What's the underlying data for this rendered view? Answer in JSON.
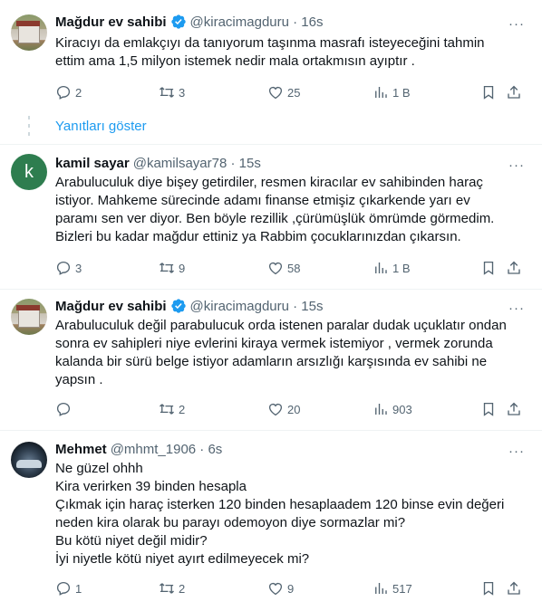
{
  "tweets": [
    {
      "name": "Mağdur ev sahibi",
      "verified": true,
      "handle_time": "@kiracimagduru · 16s",
      "text": "Kiracıyı da emlakçıyı da tanıyorum taşınma masrafı isteyeceğini tahmin\nettim ama 1,5 milyon istemek nedir mala ortakmısın ayıptır .",
      "replies": "2",
      "retweets": "3",
      "likes": "25",
      "views": "1 B"
    },
    {
      "name": "kamil sayar",
      "verified": false,
      "avatar_letter": "k",
      "handle_time": "@kamilsayar78 · 15s",
      "text": "Arabuluculuk diye bişey getirdiler, resmen kiracılar ev sahibinden haraç\nistiyor. Mahkeme sürecinde adamı finanse etmişiz çıkarkende yarı ev\nparamı sen ver diyor. Ben böyle rezillik ,çürümüşlük ömrümde görmedim.\nBizleri bu kadar mağdur ettiniz ya Rabbim çocuklarınızdan çıkarsın.",
      "replies": "3",
      "retweets": "9",
      "likes": "58",
      "views": "1 B"
    },
    {
      "name": "Mağdur ev sahibi",
      "verified": true,
      "handle_time": "@kiracimagduru · 15s",
      "text": "Arabuluculuk değil parabulucuk orda istenen paralar dudak uçuklatır ondan\nsonra ev sahipleri niye evlerini kiraya vermek istemiyor , vermek zorunda\nkalanda bir sürü belge istiyor adamların arsızlığı karşısında ev sahibi ne\nyapsın .",
      "replies": "",
      "retweets": "2",
      "likes": "20",
      "views": "903"
    },
    {
      "name": "Mehmet",
      "verified": false,
      "handle_time": "@mhmt_1906 · 6s",
      "text": "Ne güzel ohhh\nKira verirken 39 binden hesapla\nÇıkmak için haraç isterken 120 binden hesaplaadem 120 binse evin değeri\nneden kira olarak bu parayı odemoyon diye sormazlar mi?\nBu kötü niyet değil midir?\nİyi niyetle kötü niyet ayırt edilmeyecek mi?",
      "replies": "1",
      "retweets": "2",
      "likes": "9",
      "views": "517"
    }
  ],
  "show_replies_label": "Yanıtları göster",
  "more_glyph": "···",
  "colors": {
    "accent": "#1d9bf0",
    "text": "#0f1419",
    "secondary": "#536471",
    "divider": "#eff3f4"
  },
  "icons": [
    "verified-badge-icon",
    "more-icon",
    "reply-icon",
    "retweet-icon",
    "like-icon",
    "views-icon",
    "bookmark-icon",
    "share-icon"
  ]
}
